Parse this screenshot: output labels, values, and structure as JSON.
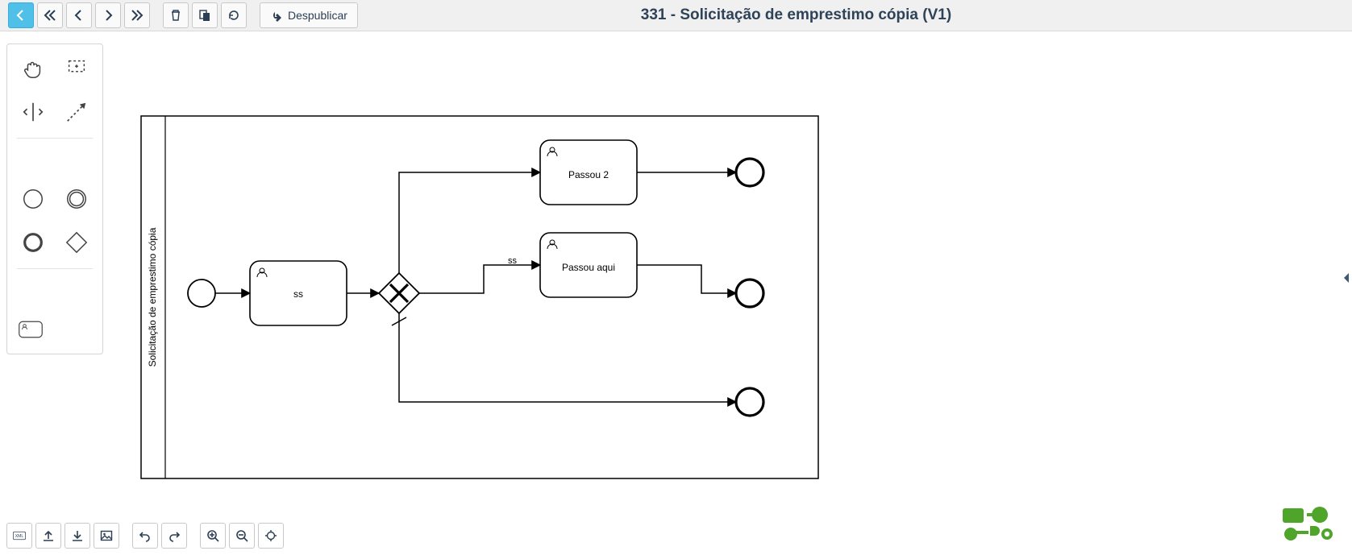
{
  "header": {
    "title": "331 - Solicitação de emprestimo cópia (V1)",
    "unpublish_label": "Despublicar"
  },
  "diagram": {
    "pool_label": "Solicitação de emprestimo cópia",
    "tasks": {
      "t1": "ss",
      "t2": "Passou 2",
      "t3": "Passou aqui"
    },
    "flow_labels": {
      "gw_to_t3": "ss"
    }
  }
}
